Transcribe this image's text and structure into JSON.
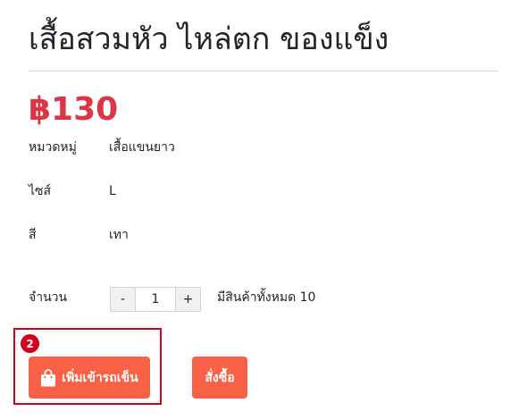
{
  "product": {
    "title": "เสื้อสวมหัว ไหล่ตก ของแข็ง",
    "price": "฿130"
  },
  "attributes": [
    {
      "label": "หมวดหมู่",
      "value": "เสื้อแขนยาว"
    },
    {
      "label": "ไซส์",
      "value": "L"
    },
    {
      "label": "สี",
      "value": "เทา"
    }
  ],
  "quantity": {
    "label": "จำนวน",
    "decrement_label": "-",
    "value": "1",
    "increment_label": "+",
    "stock_text": "มีสินค้าทั้งหมด 10"
  },
  "annotation": {
    "badge_number": "2"
  },
  "actions": {
    "add_to_cart_label": "เพิ่มเข้ารถเข็น",
    "add_to_cart_icon": "shopping-bag-icon",
    "order_label": "สั่งซื้อ"
  },
  "colors": {
    "price": "#dc3545",
    "button": "#f86145",
    "highlight": "#d0021b"
  }
}
